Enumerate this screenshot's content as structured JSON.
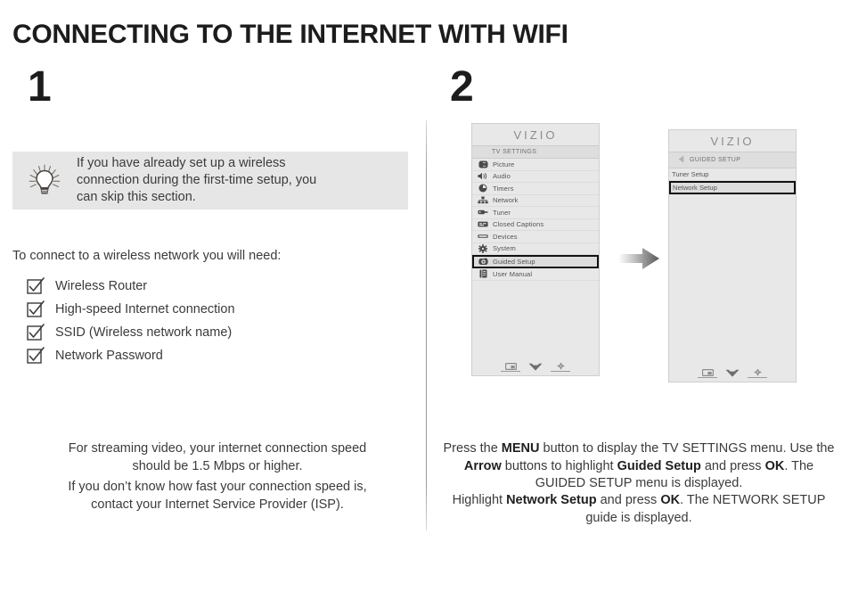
{
  "page": {
    "title": "CONNECTING TO THE INTERNET WITH WIFI"
  },
  "steps": [
    {
      "number": "1"
    },
    {
      "number": "2"
    }
  ],
  "tip": {
    "icon": "lightbulb-icon",
    "line1": "If you have already set up a wireless",
    "line2": "connection during the first-time setup, you",
    "line3": "can skip this section.",
    "background": "#e6e6e6"
  },
  "checklist": {
    "intro": "To connect to a wireless network you will need:",
    "items": [
      {
        "label": "Wireless Router",
        "icon": "checkbox-checked-icon"
      },
      {
        "label": "High-speed Internet connection",
        "icon": "checkbox-checked-icon"
      },
      {
        "label": "SSID (Wireless network name)",
        "icon": "checkbox-checked-icon"
      },
      {
        "label": "Network Password",
        "icon": "checkbox-checked-icon"
      }
    ]
  },
  "notes": {
    "note1_line1": "For streaming video, your internet connection speed",
    "note1_line2": "should be 1.5 Mbps or higher.",
    "note2_line1": "If you don’t know how fast your connection speed is,",
    "note2_line2": "contact your Internet Service Provider (ISP)."
  },
  "tv_screen_1": {
    "brand": "VIZIO",
    "header": "TV SETTINGS",
    "menu_items": [
      {
        "label": "Picture",
        "icon": "picture-icon",
        "selected": false
      },
      {
        "label": "Audio",
        "icon": "speaker-icon",
        "selected": false
      },
      {
        "label": "Timers",
        "icon": "clock-icon",
        "selected": false
      },
      {
        "label": "Network",
        "icon": "network-icon",
        "selected": false
      },
      {
        "label": "Tuner",
        "icon": "tuner-icon",
        "selected": false
      },
      {
        "label": "Closed Captions",
        "icon": "closed-captions-icon",
        "selected": false
      },
      {
        "label": "Devices",
        "icon": "devices-icon",
        "selected": false
      },
      {
        "label": "System",
        "icon": "gear-icon",
        "selected": false
      },
      {
        "label": "Guided Setup",
        "icon": "guided-setup-icon",
        "selected": true
      },
      {
        "label": "User Manual",
        "icon": "user-manual-icon",
        "selected": false
      }
    ],
    "footer_icons": [
      "input-icon",
      "chevron-down-icon",
      "gear-icon"
    ]
  },
  "tv_screen_2": {
    "brand": "VIZIO",
    "back_icon": "back-arrow-icon",
    "header": "GUIDED SETUP",
    "menu_items": [
      {
        "label": "Tuner Setup",
        "selected": false
      },
      {
        "label": "Network Setup",
        "selected": true
      }
    ],
    "footer_icons": [
      "input-icon",
      "chevron-down-icon",
      "gear-icon"
    ]
  },
  "flow": {
    "arrow_icon": "right-arrow-icon"
  },
  "caption": {
    "p1_a": "Press the ",
    "p1_b1": "MENU",
    "p1_c": " button to display the TV SETTINGS menu. Use the ",
    "p1_b2": "Arrow",
    "p1_d": " buttons to highlight ",
    "p1_b3": "Guided Setup",
    "p1_e": " and press ",
    "p1_b4": "OK",
    "p1_f": ". The GUIDED SETUP menu is displayed.",
    "p2_a": "Highlight ",
    "p2_b1": "Network Setup",
    "p2_c": " and press ",
    "p2_b2": "OK",
    "p2_d": ". The NETWORK SETUP guide is displayed."
  }
}
